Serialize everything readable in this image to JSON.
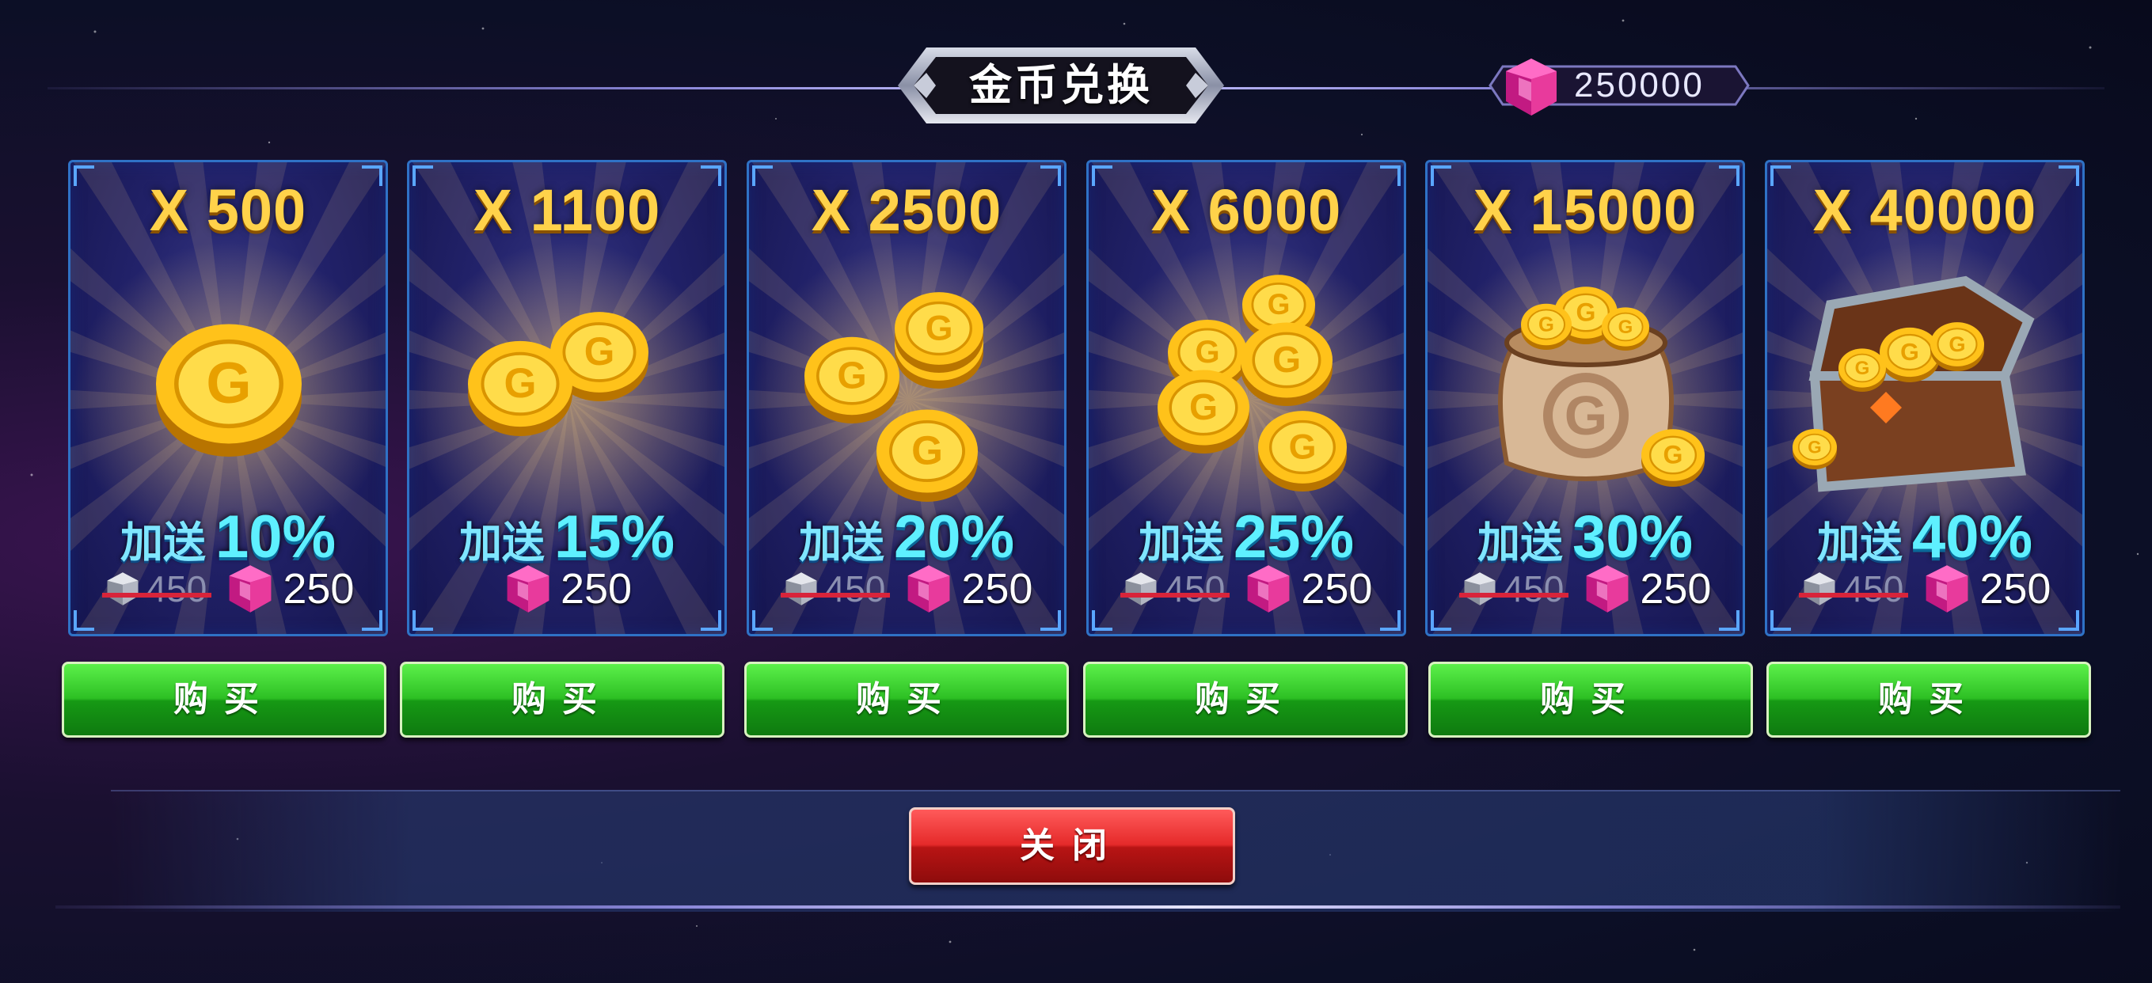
{
  "title": "金币兑换",
  "gem_balance": "250000",
  "buy_label": "购买",
  "close_label": "关闭",
  "colors": {
    "buy_green": "#2dc024",
    "close_red": "#e52a2a",
    "coin_gold": "#ffd24a",
    "bonus_cyan": "#5ef0ff",
    "gem_pink": "#e83a9c"
  },
  "packages": [
    {
      "qty": "X 500",
      "bonus_label": "加送",
      "bonus": "10%",
      "old_price": "450",
      "price": "250",
      "art": "single-coin-icon"
    },
    {
      "qty": "X 1100",
      "bonus_label": "加送",
      "bonus": "15%",
      "old_price": null,
      "price": "250",
      "art": "two-coins-icon"
    },
    {
      "qty": "X 2500",
      "bonus_label": "加送",
      "bonus": "20%",
      "old_price": "450",
      "price": "250",
      "art": "coin-stacks-icon"
    },
    {
      "qty": "X 6000",
      "bonus_label": "加送",
      "bonus": "25%",
      "old_price": "450",
      "price": "250",
      "art": "coin-pile-icon"
    },
    {
      "qty": "X 15000",
      "bonus_label": "加送",
      "bonus": "30%",
      "old_price": "450",
      "price": "250",
      "art": "coin-sack-icon"
    },
    {
      "qty": "X 40000",
      "bonus_label": "加送",
      "bonus": "40%",
      "old_price": "450",
      "price": "250",
      "art": "treasure-chest-icon"
    }
  ]
}
